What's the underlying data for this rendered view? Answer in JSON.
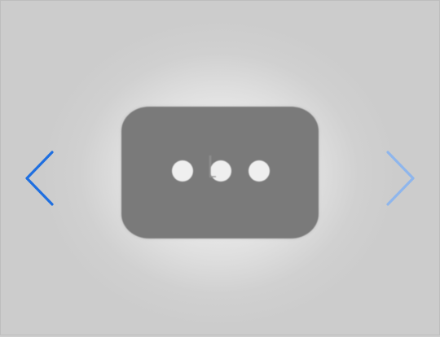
{
  "viewer": {
    "placeholder": "loading-dots-placeholder",
    "dots_count": 3,
    "colors": {
      "background": "#cdcdcd",
      "placeholder": "#7a7a7a",
      "dot": "#efefef",
      "nav_prev": "#1f6fe0",
      "nav_next": "#8fb6ec"
    }
  },
  "navigation": {
    "prev_icon": "chevron-left-icon",
    "next_icon": "chevron-right-icon"
  },
  "cursor_icon": "text-cursor-icon"
}
